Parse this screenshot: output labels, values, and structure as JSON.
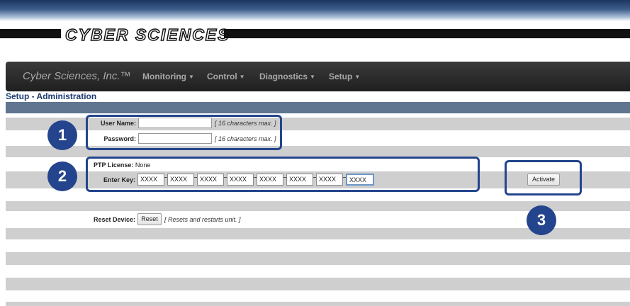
{
  "header": {
    "logo_text": "CYBER SCIENCES",
    "logo_tm": "™"
  },
  "navbar": {
    "brand": "Cyber Sciences, Inc.™",
    "menus": [
      "Monitoring",
      "Control",
      "Diagnostics",
      "Setup"
    ]
  },
  "page": {
    "title": "Setup - Administration"
  },
  "credentials": {
    "username_label": "User Name:",
    "username_value": "",
    "username_note": "[ 16 characters max. ]",
    "password_label": "Password:",
    "password_value": "",
    "password_note": "[ 16 characters max. ]"
  },
  "license": {
    "label": "PTP License:",
    "value": "None",
    "key_label": "Enter Key:",
    "key_fields": [
      "XXXX",
      "XXXX",
      "XXXX",
      "XXXX",
      "XXXX",
      "XXXX",
      "XXXX",
      "XXXX"
    ],
    "activate_label": "Activate"
  },
  "reset": {
    "label": "Reset Device:",
    "button_label": "Reset",
    "note": "[ Resets and restarts unit. ]"
  },
  "callouts": {
    "badge_1": "1",
    "badge_2": "2",
    "badge_3": "3",
    "color": "#24458d"
  }
}
